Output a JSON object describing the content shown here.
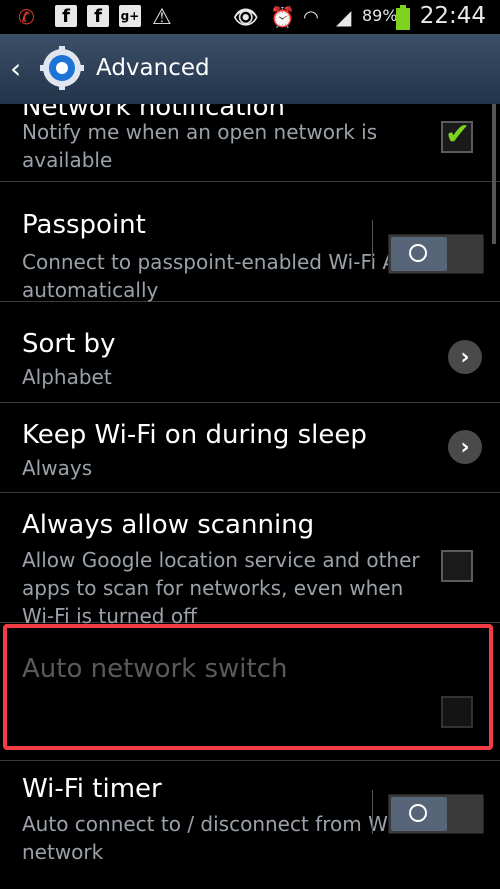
{
  "status_bar": {
    "battery_text": "89%",
    "time": "22:44",
    "icons": [
      "missed-call-icon",
      "facebook-icon",
      "facebook-icon",
      "google-plus-icon",
      "warning-icon",
      "eye-icon",
      "alarm-icon",
      "wifi-icon",
      "signal-icon",
      "battery-icon"
    ]
  },
  "action_bar": {
    "title": "Advanced"
  },
  "settings": [
    {
      "title": "Network notification",
      "subtitle": "Notify me when an open network is available",
      "control": "checkbox",
      "checked": true
    },
    {
      "title": "Passpoint",
      "subtitle": "Connect to passpoint-enabled Wi-Fi APs automatically",
      "control": "toggle",
      "on": false
    },
    {
      "title": "Sort by",
      "subtitle": "Alphabet",
      "control": "chevron"
    },
    {
      "title": "Keep Wi-Fi on during sleep",
      "subtitle": "Always",
      "control": "chevron"
    },
    {
      "title": "Always allow scanning",
      "subtitle": "Allow Google location service and other apps to scan for networks, even when Wi-Fi is turned off",
      "control": "checkbox",
      "checked": false
    },
    {
      "title": "Auto network switch",
      "subtitle": "",
      "control": "checkbox",
      "checked": false,
      "enabled": false
    },
    {
      "title": "Wi-Fi timer",
      "subtitle": "Auto connect to / disconnect from Wi-Fi network",
      "control": "toggle",
      "on": false
    }
  ],
  "colors": {
    "highlight": "#f23d46",
    "check": "#7ed321",
    "actionbar": "#2c3f57"
  }
}
